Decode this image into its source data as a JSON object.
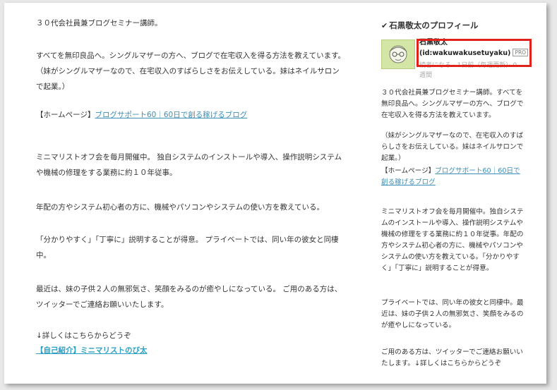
{
  "main": {
    "p1": "３０代会社員兼ブログセミナー講師。",
    "p2": "すべてを無印良品へ。シングルマザーの方へ、ブログで在宅収入を得る方法を教えています。（妹がシングルマザーなので、在宅収入のすばらしさをお伝えしている。妹はネイルサロンで起業。）",
    "homepage_label": "【ホームページ】",
    "homepage_link": "ブログサポート60｜60日で創る稼げるブログ",
    "p3": "ミニマリストオフ会を毎月開催中。 独自システムのインストールや導入、操作説明システムや機械の修理をする業務に約１０年従事。",
    "p4": "年配の方やシステム初心者の方に、機械やパソコンやシステムの使い方を教えている。",
    "p5": "「分かりやすく」「丁寧に」説明することが得意。 プライベートでは、同い年の彼女と同棲中。",
    "p6": "最近は、妹の子供２人の無邪気さ、笑顔をみるのが癒やしになっている。 ご用のある方は、ツイッターでご連絡お願いいたします。",
    "p7": "↓詳しくはこちらからどうぞ",
    "intro_link": "【自己紹介】ミニマリストのび太"
  },
  "sidebar": {
    "title": "石黒敬太のプロフィール",
    "name": "石黒敬太",
    "id": "(id:wakuwakusetuyaku)",
    "pro": "PRO",
    "meta": "読者になる · 1日前（毎週更新）· 0 週間",
    "s1": "３０代会社員兼ブログセミナー講師。すべてを無印良品へ。シングルマザーの方へ、ブログで在宅収入を得る方法を教えています。",
    "s2": "（妹がシングルマザーなので、在宅収入のすばらしさをお伝えしている。妹はネイルサロンで起業。）",
    "homepage_label": "【ホームページ】",
    "homepage_link": "ブログサポート60｜60日で創る稼げるブログ",
    "s3": "ミニマリストオフ会を毎月開催中。独自システムのインストールや導入、操作説明システムや機械の修理をする業務に約１０年従事。年配の方やシステム初心者の方に、機械やパソコンやシステムの使い方を教えている。「分かりやすく」「丁寧に」説明することが得意。",
    "s4": "プライベートでは、同い年の彼女と同棲中。最近は、妹の子供２人の無邪気さ、笑顔をみるのが癒やしになっている。",
    "s5": "ご用のある方は、ツイッターでご連絡お願いいたします。↓詳しくはこちらからどうぞ"
  },
  "colors": {
    "link": "#3b8fb7",
    "highlight": "#e0221b"
  }
}
